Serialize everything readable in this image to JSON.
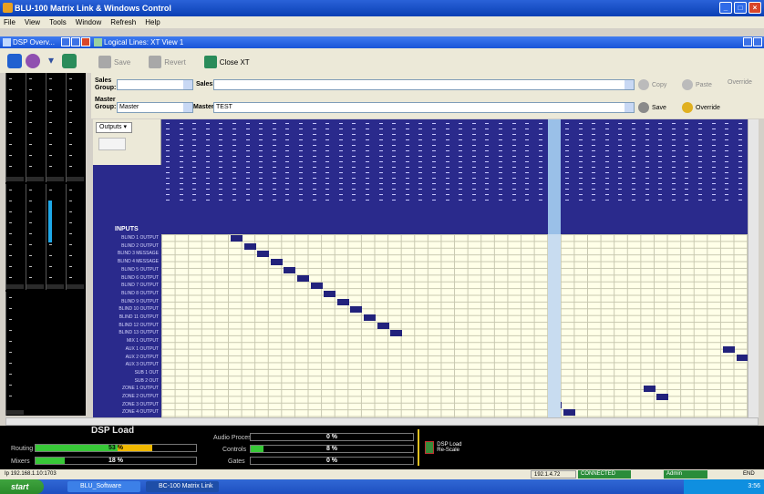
{
  "window": {
    "title": "BLU-100 Matrix Link & Windows Control"
  },
  "menu": [
    "File",
    "View",
    "Tools",
    "Window",
    "Refresh",
    "Help"
  ],
  "left_panel": {
    "title": "DSP Overv..."
  },
  "document": {
    "title": "Logical Lines: XT View 1"
  },
  "toolbar": {
    "btn1": "Save",
    "btn2": "Revert",
    "btn3": "Close XT"
  },
  "form": {
    "sales_group_label": "Sales Group:",
    "sales_group_value": "",
    "sales_label": "Sales:",
    "sales_value": "",
    "master_group_label": "Master Group:",
    "master_group_value": "Master",
    "master_label": "Master:",
    "master_value": "TEST",
    "btn_copy": "Copy",
    "btn_paste": "Paste",
    "btn_override": "Override",
    "btn_save": "Save",
    "btn_override2": "Override"
  },
  "matrix": {
    "corner_select": "Outputs",
    "outputs_label": "INPUTS",
    "rows": [
      "BLIND 1 OUTPUT",
      "BLIND 2 OUTPUT",
      "BLIND 3 MESSAGE",
      "BLIND 4 MESSAGE",
      "BLIND 5 OUTPUT",
      "BLIND 6 OUTPUT",
      "BLIND 7 OUTPUT",
      "BLIND 8 OUTPUT",
      "BLIND 9 OUTPUT",
      "BLIND 10 OUTPUT",
      "BLIND 11 OUTPUT",
      "BLIND 12 OUTPUT",
      "BLIND 13 OUTPUT",
      "MIX 1 OUTPUT",
      "AUX 1 OUTPUT",
      "AUX 2 OUTPUT",
      "AUX 3 OUTPUT",
      "SUB 1 OUT",
      "SUB 2 OUT",
      "ZONE 1 OUTPUT",
      "ZONE 2 OUTPUT",
      "ZONE 3 OUTPUT",
      "ZONE 4 OUTPUT"
    ]
  },
  "dsp": {
    "title": "DSP Load",
    "routing_label": "Routing",
    "routing_value": "53 %",
    "mixers_label": "Mixers",
    "mixers_value": "18 %",
    "audio_process_label": "Audio Process",
    "audio_process_value": "0 %",
    "controls_label": "Controls",
    "controls_value": "8 %",
    "gates_label": "Gates",
    "gates_value": "0 %",
    "button_label": "DSP Load Re-Scale"
  },
  "status": {
    "left": "Ip 192.168.1.10:1703",
    "s1": "192.1.4.72",
    "s2": "CONNECTED",
    "s3": "Admin",
    "s4": "END"
  },
  "taskbar": {
    "start": "start",
    "task1": "BLU_Software",
    "task2": "BC-100 Matrix Link",
    "clock": "3:56"
  }
}
